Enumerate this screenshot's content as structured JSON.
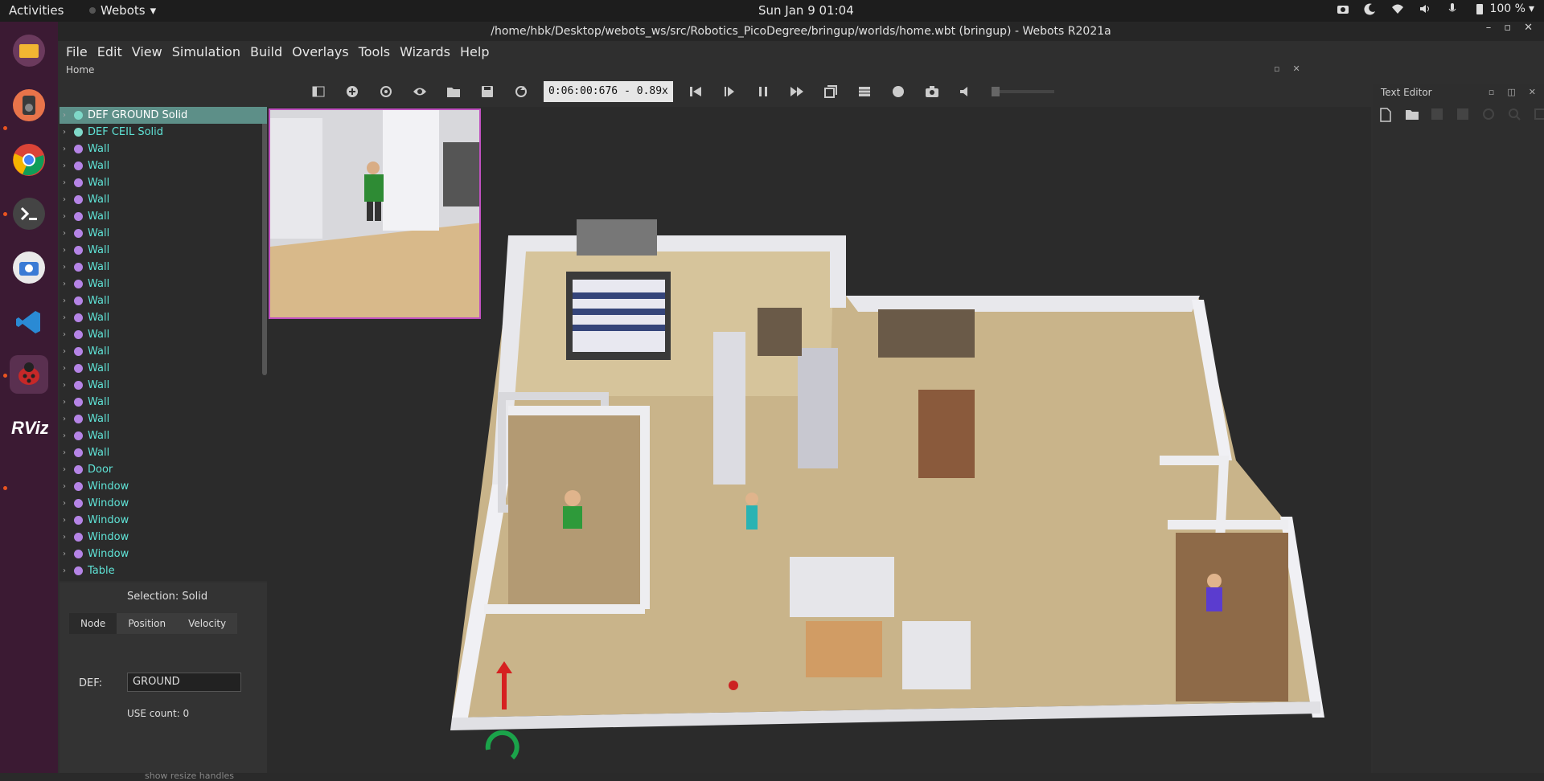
{
  "topbar": {
    "activities": "Activities",
    "app_name": "Webots",
    "clock": "Sun Jan 9  01:04",
    "battery": "100 %"
  },
  "window": {
    "title": "/home/hbk/Desktop/webots_ws/src/Robotics_PicoDegree/bringup/worlds/home.wbt (bringup) - Webots R2021a"
  },
  "menu": [
    "File",
    "Edit",
    "View",
    "Simulation",
    "Build",
    "Overlays",
    "Tools",
    "Wizards",
    "Help"
  ],
  "home_tab": "Home",
  "toolbar": {
    "time": "0:06:00:676",
    "speed": "- 0.89x"
  },
  "scene_tree": [
    {
      "label": "DEF GROUND Solid",
      "kind": "solid",
      "selected": true
    },
    {
      "label": "DEF CEIL Solid",
      "kind": "solid"
    },
    {
      "label": "Wall"
    },
    {
      "label": "Wall"
    },
    {
      "label": "Wall"
    },
    {
      "label": "Wall"
    },
    {
      "label": "Wall"
    },
    {
      "label": "Wall"
    },
    {
      "label": "Wall"
    },
    {
      "label": "Wall"
    },
    {
      "label": "Wall"
    },
    {
      "label": "Wall"
    },
    {
      "label": "Wall"
    },
    {
      "label": "Wall"
    },
    {
      "label": "Wall"
    },
    {
      "label": "Wall"
    },
    {
      "label": "Wall"
    },
    {
      "label": "Wall"
    },
    {
      "label": "Wall"
    },
    {
      "label": "Wall"
    },
    {
      "label": "Wall"
    },
    {
      "label": "Door"
    },
    {
      "label": "Window"
    },
    {
      "label": "Window"
    },
    {
      "label": "Window"
    },
    {
      "label": "Window"
    },
    {
      "label": "Window"
    },
    {
      "label": "Table"
    }
  ],
  "field_editor": {
    "selection": "Selection: Solid",
    "tabs": [
      "Node",
      "Position",
      "Velocity"
    ],
    "def_label": "DEF:",
    "def_value": "GROUND",
    "use_count": "USE count: 0",
    "show_handles": "show resize handles"
  },
  "text_editor": {
    "title": "Text Editor"
  },
  "colors": {
    "accent": "#5d8f88",
    "tree_text": "#5fe3d6",
    "camera_border": "#c050c0",
    "dock": "#3b1a33"
  }
}
